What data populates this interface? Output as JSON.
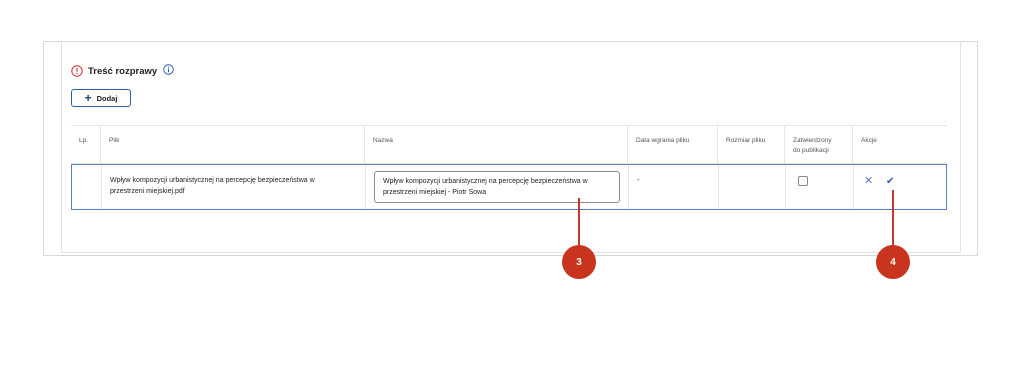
{
  "section": {
    "title": "Treść rozprawy",
    "add_label": "Dodaj"
  },
  "table": {
    "headers": {
      "lp": "Lp.",
      "plik": "Plik",
      "nazwa": "Nazwa",
      "data": "Data wgrania pliku",
      "rozmiar": "Rozmiar pliku",
      "zatwierdzony_1": "Zatwierdzony",
      "zatwierdzony_2": "do publikacji",
      "akcje": "Akcje"
    },
    "row": {
      "plik_1": "Wpływ kompozycji urbanistycznej na percepcję bezpieczeństwa w",
      "plik_2": "przestrzeni miejskiej.pdf",
      "nazwa_value": "Wpływ kompozycji urbanistycznej na percepcję bezpieczeństwa w przestrzeni miejskiej - Piotr Sowa",
      "data": "-",
      "zatwierdzony": false
    }
  },
  "callouts": {
    "c3": "3",
    "c4": "4"
  },
  "colors": {
    "accent": "#2a5db0",
    "callout": "#c8341d",
    "warning": "#d32f2f"
  },
  "icons": {
    "warning": "warning-circle-icon",
    "info": "info-icon",
    "add": "plus-icon",
    "cancel": "close-icon",
    "confirm": "check-icon"
  }
}
